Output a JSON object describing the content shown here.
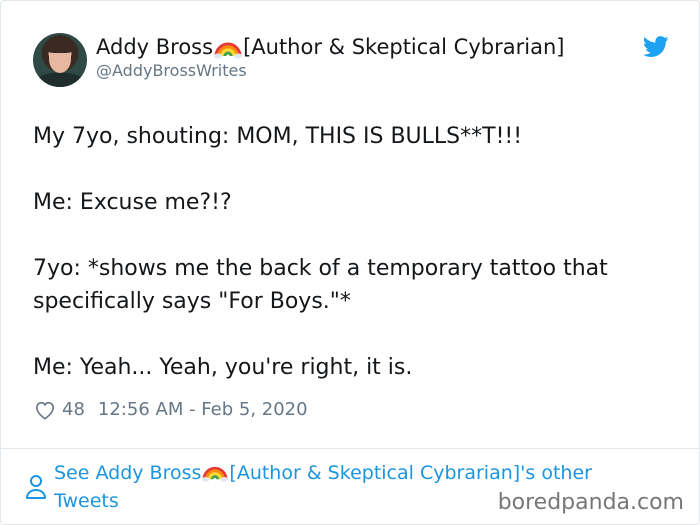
{
  "author": {
    "name": "Addy Bross",
    "name_suffix": "[Author & Skeptical Cybrarian]",
    "handle": "@AddyBrossWrites",
    "name_emoji_icon": "rainbow-icon"
  },
  "tweet": {
    "lines": [
      "My 7yo, shouting: MOM, THIS IS BULLS**T!!!",
      "Me: Excuse me?!?",
      "7yo: *shows me the back of a temporary tattoo that specifically says \"For Boys.\"*",
      "Me: Yeah... Yeah, you're right, it is."
    ],
    "likes": "48",
    "timestamp": "12:56 AM - Feb 5, 2020"
  },
  "footer": {
    "link_prefix": "See Addy Bross",
    "link_suffix": "[Author & Skeptical Cybrarian]'s other Tweets"
  },
  "watermark": "boredpanda.com",
  "colors": {
    "link_blue": "#1b95e0",
    "twitter_blue": "#1da1f2",
    "muted_gray": "#657786",
    "text": "#14171a"
  },
  "icons": [
    "twitter-bird-icon",
    "heart-icon",
    "person-icon",
    "rainbow-icon"
  ]
}
